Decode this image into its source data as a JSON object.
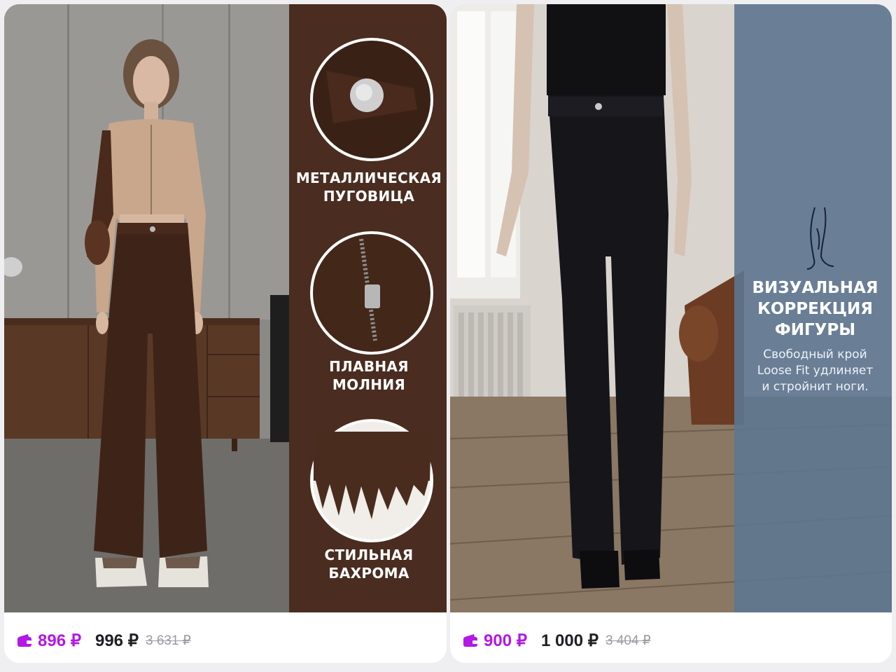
{
  "products": [
    {
      "features": [
        {
          "icon": "metal-button-closeup",
          "title": "МЕТАЛЛИЧЕСКАЯ\nПУГОВИЦА"
        },
        {
          "icon": "zipper-closeup",
          "title": "ПЛАВНАЯ\nМОЛНИЯ"
        },
        {
          "icon": "fringe-closeup",
          "title": "СТИЛЬНАЯ\nБАХРОМА"
        }
      ],
      "price_wallet": "896 ₽",
      "price": "996 ₽",
      "price_old": "3 631 ₽",
      "panel_color": "#4a2d20",
      "pants_color": "#3e2418"
    },
    {
      "overlay_icon": "legs-outline-icon",
      "overlay_title": "ВИЗУАЛЬНАЯ\nКОРРЕКЦИЯ\nФИГУРЫ",
      "overlay_desc": "Свободный крой\nLoose Fit удлиняет\nи стройнит ноги.",
      "price_wallet": "900 ₽",
      "price": "1 000 ₽",
      "price_old": "3 404 ₽",
      "panel_color": "#5d7590",
      "pants_color": "#15151a"
    }
  ],
  "colors": {
    "wallet_accent": "#b417e6",
    "price_text": "#1f1f24",
    "old_price": "#9a9aa3"
  }
}
